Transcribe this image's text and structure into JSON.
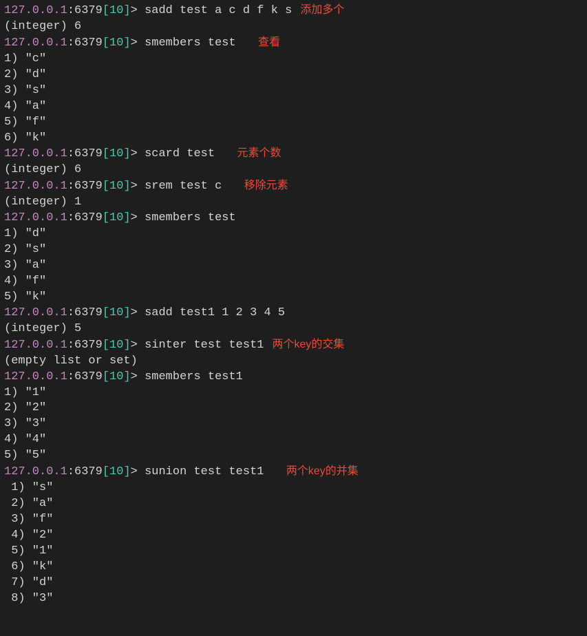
{
  "prompt": {
    "host": "127.0.0.1",
    "port": ":6379",
    "lb": "[",
    "db": "10",
    "rb": "]",
    "arrow": "> "
  },
  "lines": [
    {
      "type": "cmd",
      "cmd": "sadd test a c d f k s",
      "annotation": "添加多个"
    },
    {
      "type": "out",
      "text": "(integer) 6"
    },
    {
      "type": "cmd",
      "cmd": "smembers test",
      "annotation": "查看",
      "annoPad": "  "
    },
    {
      "type": "out",
      "text": "1) \"c\""
    },
    {
      "type": "out",
      "text": "2) \"d\""
    },
    {
      "type": "out",
      "text": "3) \"s\""
    },
    {
      "type": "out",
      "text": "4) \"a\""
    },
    {
      "type": "out",
      "text": "5) \"f\""
    },
    {
      "type": "out",
      "text": "6) \"k\""
    },
    {
      "type": "cmd",
      "cmd": "scard test",
      "annotation": "元素个数",
      "annoPad": "  "
    },
    {
      "type": "out",
      "text": "(integer) 6"
    },
    {
      "type": "cmd",
      "cmd": "srem test c",
      "annotation": "移除元素",
      "annoPad": "  "
    },
    {
      "type": "out",
      "text": "(integer) 1"
    },
    {
      "type": "cmd",
      "cmd": "smembers test"
    },
    {
      "type": "out",
      "text": "1) \"d\""
    },
    {
      "type": "out",
      "text": "2) \"s\""
    },
    {
      "type": "out",
      "text": "3) \"a\""
    },
    {
      "type": "out",
      "text": "4) \"f\""
    },
    {
      "type": "out",
      "text": "5) \"k\""
    },
    {
      "type": "cmd",
      "cmd": "sadd test1 1 2 3 4 5"
    },
    {
      "type": "out",
      "text": "(integer) 5"
    },
    {
      "type": "cmd",
      "cmd": "sinter test test1",
      "annotation": "两个key的交集",
      "annoPad": ""
    },
    {
      "type": "out",
      "text": "(empty list or set)"
    },
    {
      "type": "cmd",
      "cmd": "smembers test1"
    },
    {
      "type": "out",
      "text": "1) \"1\""
    },
    {
      "type": "out",
      "text": "2) \"2\""
    },
    {
      "type": "out",
      "text": "3) \"3\""
    },
    {
      "type": "out",
      "text": "4) \"4\""
    },
    {
      "type": "out",
      "text": "5) \"5\""
    },
    {
      "type": "cmd",
      "cmd": "sunion test test1",
      "annotation": "两个key的并集",
      "annoPad": "  "
    },
    {
      "type": "out",
      "text": " 1) \"s\""
    },
    {
      "type": "out",
      "text": " 2) \"a\""
    },
    {
      "type": "out",
      "text": " 3) \"f\""
    },
    {
      "type": "out",
      "text": " 4) \"2\""
    },
    {
      "type": "out",
      "text": " 5) \"1\""
    },
    {
      "type": "out",
      "text": " 6) \"k\""
    },
    {
      "type": "out",
      "text": " 7) \"d\""
    },
    {
      "type": "out",
      "text": " 8) \"3\""
    }
  ]
}
